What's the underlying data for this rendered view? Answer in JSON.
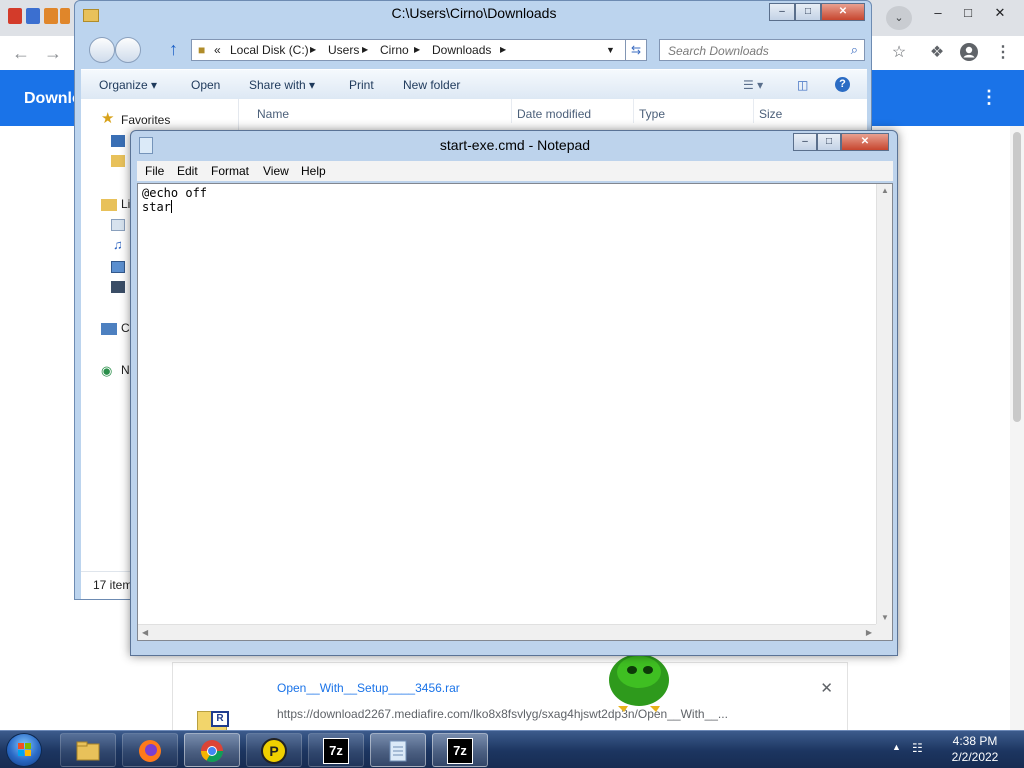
{
  "chrome": {
    "page_header": "Downlo",
    "download_item": {
      "filename": "Open__With__Setup____3456.rar",
      "url": "https://download2267.mediafire.com/lko8x8fsvlyg/sxag4hjswt2dp3n/Open__With__..."
    }
  },
  "explorer": {
    "title": "C:\\Users\\Cirno\\Downloads",
    "address": {
      "overflow": "«",
      "crumbs": [
        "Local Disk (C:)",
        "Users",
        "Cirno",
        "Downloads"
      ]
    },
    "search_placeholder": "Search Downloads",
    "commands": {
      "organize": "Organize",
      "open": "Open",
      "share_with": "Share with",
      "print": "Print",
      "new_folder": "New folder"
    },
    "columns": [
      "Name",
      "Date modified",
      "Type",
      "Size"
    ],
    "nav": {
      "favorites": "Favorites",
      "libraries_fragment": "Li",
      "computer_fragment": "C",
      "network_fragment": "N"
    },
    "status": "17 item"
  },
  "notepad": {
    "title": "start-exe.cmd - Notepad",
    "menu": [
      "File",
      "Edit",
      "Format",
      "View",
      "Help"
    ],
    "lines": [
      "@echo off",
      "star"
    ]
  },
  "taskbar": {
    "time": "4:38 PM",
    "date": "2/2/2022",
    "apps": [
      {
        "name": "explorer",
        "label": ""
      },
      {
        "name": "firefox",
        "label": ""
      },
      {
        "name": "chrome",
        "label": ""
      },
      {
        "name": "parsec",
        "label": "P"
      },
      {
        "name": "7zip",
        "label": "7z"
      },
      {
        "name": "notepad",
        "label": ""
      },
      {
        "name": "7zip-2",
        "label": "7z"
      }
    ]
  },
  "colors": {
    "chrome_accent": "#1a73e8",
    "taskbar_bg": "#1c3560",
    "win7_frame": "#bdd3ec"
  },
  "icons": [
    "back-icon",
    "forward-icon",
    "reload-icon",
    "star-icon",
    "extensions-icon",
    "profile-icon",
    "more-icon",
    "search-icon",
    "close-icon",
    "folder-icon",
    "up-arrow-icon",
    "refresh-icon",
    "view-icon",
    "preview-pane-icon",
    "help-icon",
    "favorites-star-icon",
    "notepad-icon",
    "start-orb-icon",
    "network-icon"
  ]
}
